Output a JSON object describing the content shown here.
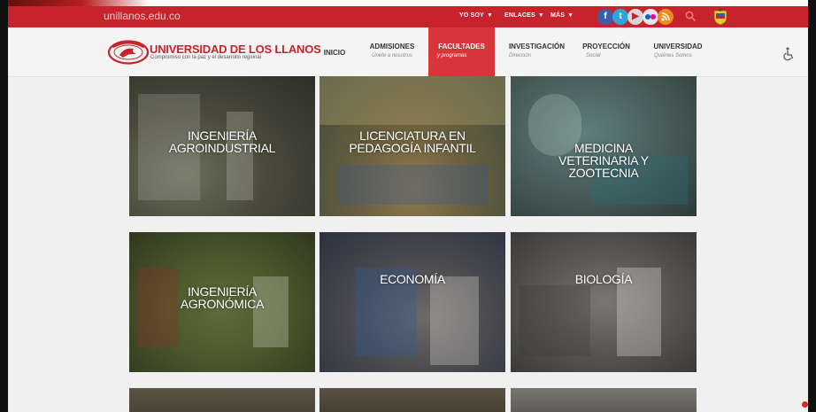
{
  "topbar": {
    "domain": "unillanos.edu.co",
    "menus": [
      "YO SOY",
      "ENLACES",
      "MÁS"
    ],
    "social_icons": [
      "facebook-icon",
      "twitter-icon",
      "youtube-icon",
      "flickr-icon",
      "rss-icon"
    ],
    "accent": "#c8232c"
  },
  "logo": {
    "title": "UNIVERSIDAD DE LOS LLANOS",
    "subtitle": "Compromiso con la paz y el desarrollo regional"
  },
  "nav": [
    {
      "label": "INICIO",
      "sub": ""
    },
    {
      "label": "ADMISIONES",
      "sub": "Únete a nosotros"
    },
    {
      "label": "FACULTADES",
      "sub": "y programas",
      "active": true
    },
    {
      "label": "INVESTIGACIÓN",
      "sub": "Dirección"
    },
    {
      "label": "PROYECCIÓN",
      "sub": "Social"
    },
    {
      "label": "UNIVERSIDAD",
      "sub": "Quiénes Somos"
    }
  ],
  "programs": [
    {
      "lines": [
        "INGENIERÍA",
        "AGROINDUSTRIAL"
      ]
    },
    {
      "lines": [
        "LICENCIATURA EN",
        "PEDAGOGÍA INFANTIL"
      ]
    },
    {
      "lines": [
        "MEDICINA",
        "VETERINARIA Y",
        "ZOOTECNIA"
      ]
    },
    {
      "lines": [
        "INGENIERÍA",
        "AGRONÓMICA"
      ]
    },
    {
      "lines": [
        "ECONOMÍA"
      ]
    },
    {
      "lines": [
        "BIOLOGÍA"
      ]
    }
  ]
}
